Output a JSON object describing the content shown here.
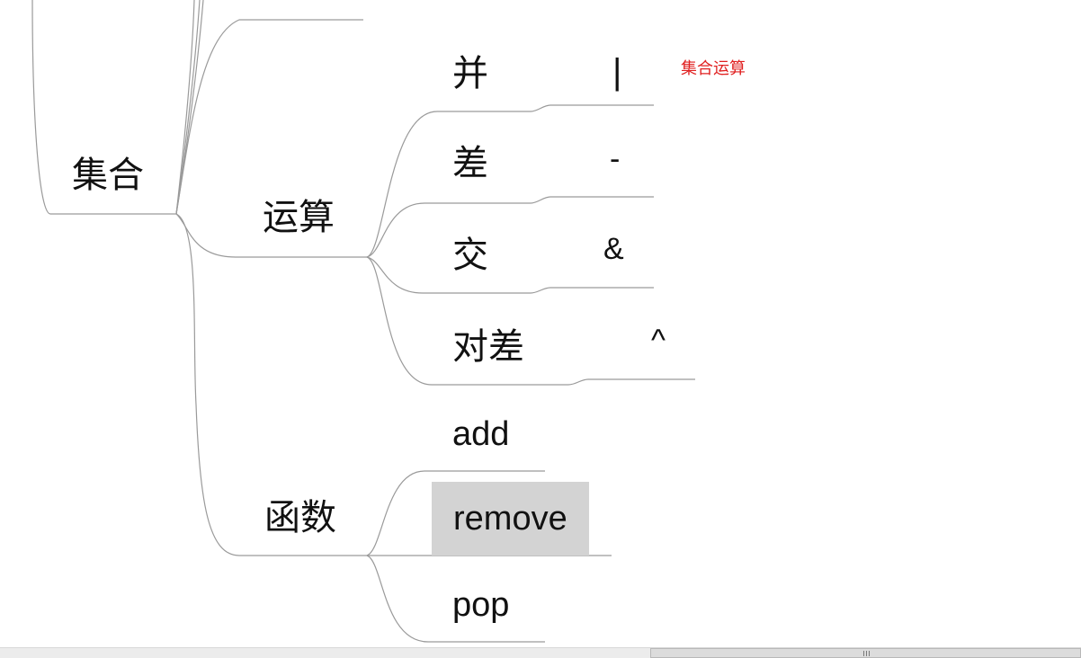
{
  "mindmap": {
    "root": {
      "label": "集合"
    },
    "ops": {
      "label": "运算",
      "items": [
        {
          "label": "并",
          "symbol": "|",
          "note": "集合运算"
        },
        {
          "label": "差",
          "symbol": "-"
        },
        {
          "label": "交",
          "symbol": "&"
        },
        {
          "label": "对差",
          "symbol": "^"
        }
      ]
    },
    "funcs": {
      "label": "函数",
      "items": [
        {
          "label": "add"
        },
        {
          "label": "remove",
          "selected": true
        },
        {
          "label": "pop"
        }
      ]
    }
  },
  "colors": {
    "line": "#9a9a9a",
    "text": "#111111",
    "note": "#e02020",
    "selection": "#d3d3d3",
    "background": "#ffffff"
  }
}
